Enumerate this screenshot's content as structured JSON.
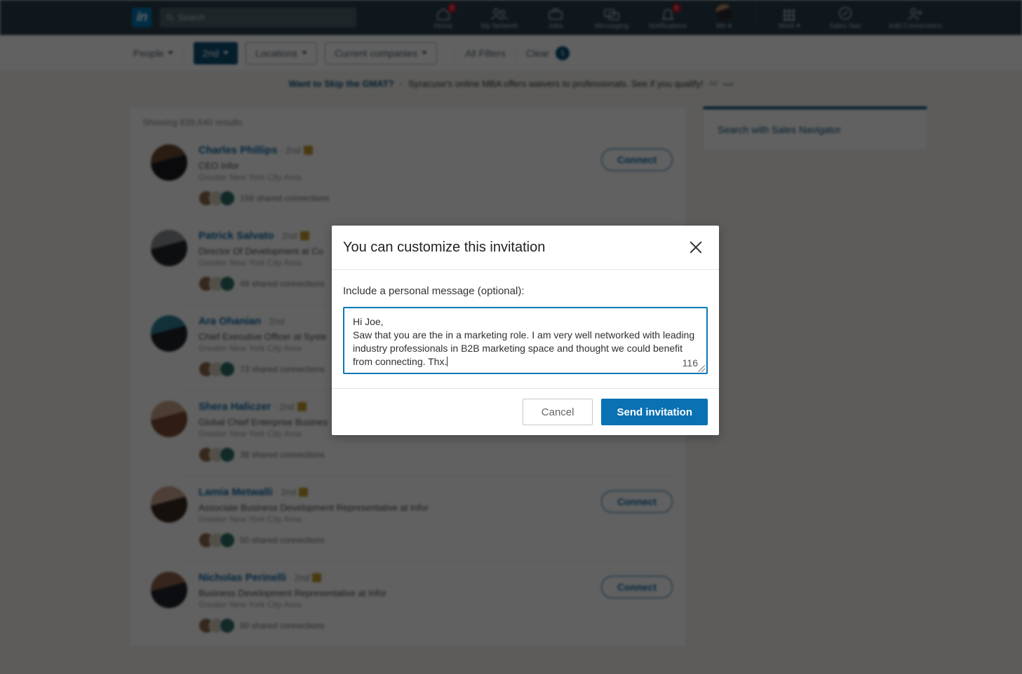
{
  "nav": {
    "logo": "in",
    "search_placeholder": "Search",
    "search_value": "",
    "items": [
      {
        "label": "Home",
        "icon": "home-icon",
        "badge": "5"
      },
      {
        "label": "My Network",
        "icon": "my-network-icon",
        "badge": ""
      },
      {
        "label": "Jobs",
        "icon": "jobs-icon",
        "badge": ""
      },
      {
        "label": "Messaging",
        "icon": "messaging-icon",
        "badge": ""
      },
      {
        "label": "Notifications",
        "icon": "notifications-icon",
        "badge": "5"
      },
      {
        "label": "Me",
        "icon": "avatar-icon",
        "badge": ""
      }
    ],
    "right_items": [
      {
        "label": "Work",
        "icon": "grid-icon"
      },
      {
        "label": "Sales Nav",
        "icon": "compass-icon"
      },
      {
        "label": "Add Connections",
        "icon": "add-person-icon"
      }
    ]
  },
  "filters": {
    "people": "People",
    "degree": "2nd",
    "locations": "Locations",
    "companies": "Current companies",
    "all_filters": "All Filters",
    "clear": "Clear",
    "clear_count": "1",
    "accent": "#0b4f74"
  },
  "ad": {
    "headline": "Want to Skip the GMAT?",
    "separator": "-",
    "body": "Syracuse's online MBA offers waivers to professionals. See if you qualify!",
    "tag": "Ad",
    "menu": "•••"
  },
  "results": {
    "showing": "Showing 839,640 results",
    "connect_label": "Connect",
    "degree_suffix": "2nd",
    "separator": "·",
    "items": [
      {
        "name": "Charles Phillips",
        "degree": "2nd",
        "title": "CEO Infor",
        "location": "Greater New York City Area",
        "shared": "159 shared connections",
        "has_inmail": true,
        "avatar_a": "#6a4a34",
        "avatar_b": "#1b1b20",
        "show_connect": true
      },
      {
        "name": "Patrick Salvato",
        "degree": "2nd",
        "title": "Director Of Development at Co",
        "location": "Greater New York City Area",
        "shared": "49 shared connections",
        "has_inmail": true,
        "avatar_a": "#8a8f93",
        "avatar_b": "#24272b",
        "show_connect": false
      },
      {
        "name": "Ara Ohanian",
        "degree": "2nd",
        "title": "Chief Executive Officer at Syste",
        "location": "Greater New York City Area",
        "shared": "73 shared connections",
        "has_inmail": false,
        "avatar_a": "#2e7f94",
        "avatar_b": "#1d2228",
        "show_connect": false
      },
      {
        "name": "Shera Haliczer",
        "degree": "2nd",
        "title": "Global Chief Enterprise Busines",
        "location": "Greater New York City Area",
        "shared": "38 shared connections",
        "has_inmail": true,
        "avatar_a": "#c9a28a",
        "avatar_b": "#7b4a33",
        "show_connect": false
      },
      {
        "name": "Lamia Metwalli",
        "degree": "2nd",
        "title": "Associate Business Development Representative at Infor",
        "location": "Greater New York City Area",
        "shared": "50 shared connections",
        "has_inmail": true,
        "avatar_a": "#caa58e",
        "avatar_b": "#3a2a22",
        "show_connect": true
      },
      {
        "name": "Nicholas Perinelli",
        "degree": "2nd",
        "title": "Business Development Representative at Infor",
        "location": "Greater New York City Area",
        "shared": "50 shared connections",
        "has_inmail": true,
        "avatar_a": "#8c6248",
        "avatar_b": "#1f242b",
        "show_connect": true
      }
    ]
  },
  "rail": {
    "sales_navigator": "Search with Sales Navigator"
  },
  "modal": {
    "title": "You can customize this invitation",
    "close_icon": "close-icon",
    "label": "Include a personal message (optional):",
    "message": "Hi Joe,\nSaw that you are the in a marketing role. I am very well networked with leading industry professionals in B2B marketing space and thought we could benefit from connecting. Thx.",
    "char_count": "116",
    "cancel_label": "Cancel",
    "send_label": "Send invitation",
    "send_color": "#0a71b2"
  }
}
